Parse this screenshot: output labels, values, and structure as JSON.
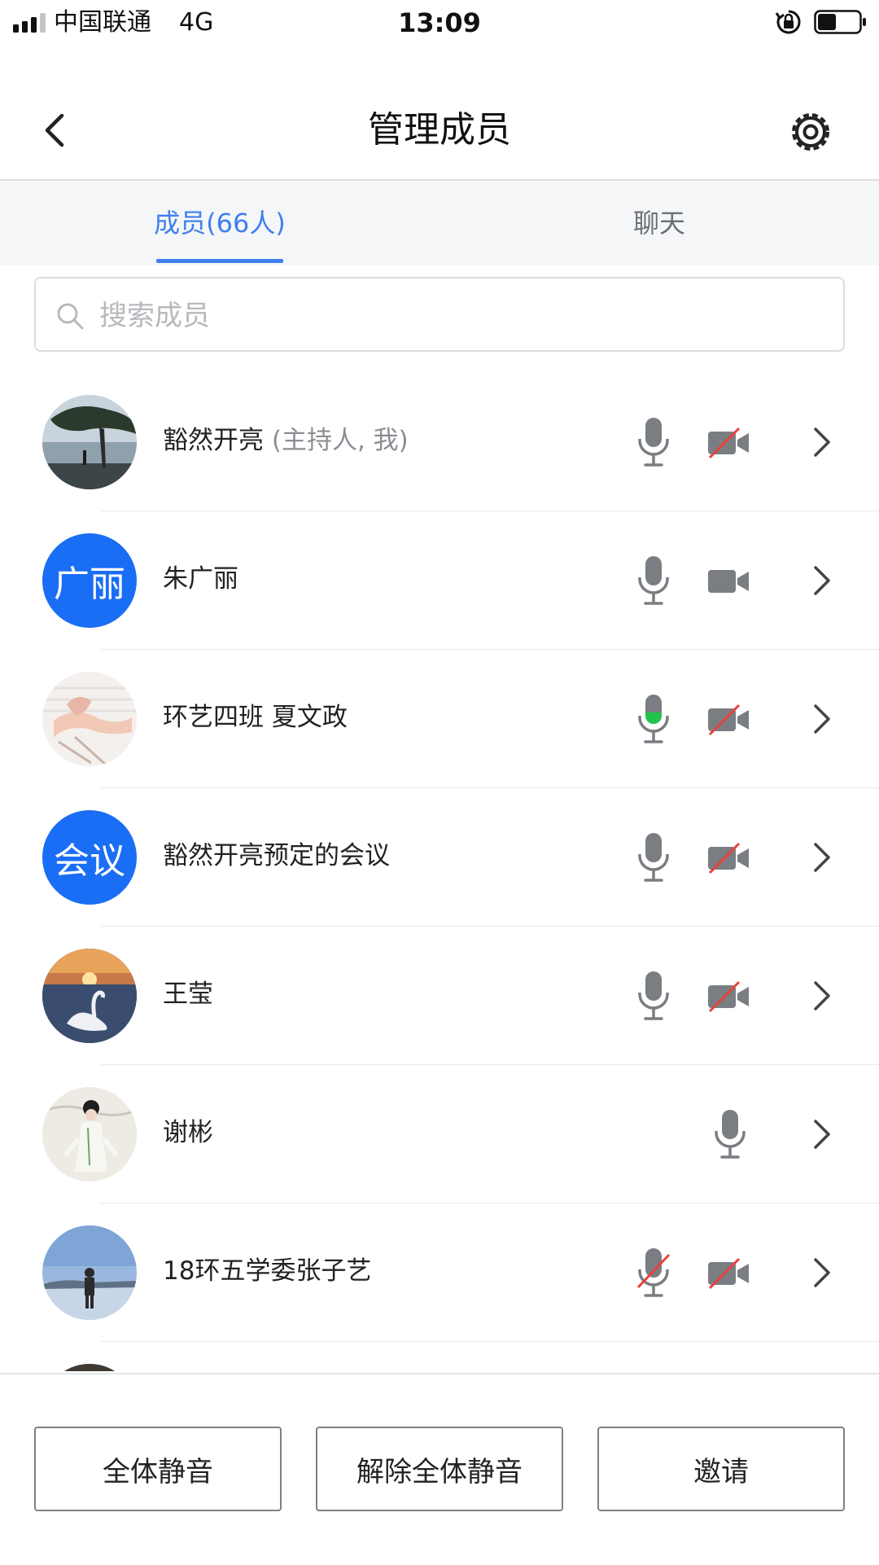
{
  "status_bar": {
    "carrier": "中国联通",
    "network": "4G",
    "time": "13:09",
    "signal_bars": 4,
    "signal_active": 3,
    "battery_level": 0.45
  },
  "header": {
    "title": "管理成员",
    "back_icon": "chevron-left-icon",
    "settings_icon": "gear-icon"
  },
  "tabs": [
    {
      "label": "成员(66人)",
      "active": true
    },
    {
      "label": "聊天",
      "active": false
    }
  ],
  "search": {
    "placeholder": "搜索成员",
    "value": ""
  },
  "members": [
    {
      "name": "豁然开亮",
      "role": "(主持人, 我)",
      "avatar": "tree-lake-photo",
      "mic": "idle",
      "camera": "off"
    },
    {
      "name": "朱广丽",
      "role": "",
      "avatar_text": "广丽",
      "mic": "idle",
      "camera": "on"
    },
    {
      "name": "环艺四班 夏文政",
      "role": "",
      "avatar": "anime-character-photo",
      "mic": "speaking",
      "camera": "off"
    },
    {
      "name": "豁然开亮预定的会议",
      "role": "",
      "avatar_text": "会议",
      "mic": "idle",
      "camera": "off"
    },
    {
      "name": "王莹",
      "role": "",
      "avatar": "swan-sunset-photo",
      "mic": "idle",
      "camera": "off"
    },
    {
      "name": "谢彬",
      "role": "",
      "avatar": "hanfu-girl-photo",
      "mic": "idle",
      "camera": "none"
    },
    {
      "name": "18环五学委张子艺",
      "role": "",
      "avatar": "seaside-person-photo",
      "mic": "muted",
      "camera": "off"
    },
    {
      "name": "",
      "role": "",
      "avatar": "partial-photo",
      "mic": "none",
      "camera": "none"
    }
  ],
  "actions": {
    "mute_all": "全体静音",
    "unmute_all": "解除全体静音",
    "invite": "邀请"
  },
  "colors": {
    "accent": "#3f7ff0",
    "avatar_blue": "#1a6ef5",
    "icon_gray": "#7a7d82",
    "speaking_green": "#22c34a",
    "muted_red": "#e8413b"
  }
}
